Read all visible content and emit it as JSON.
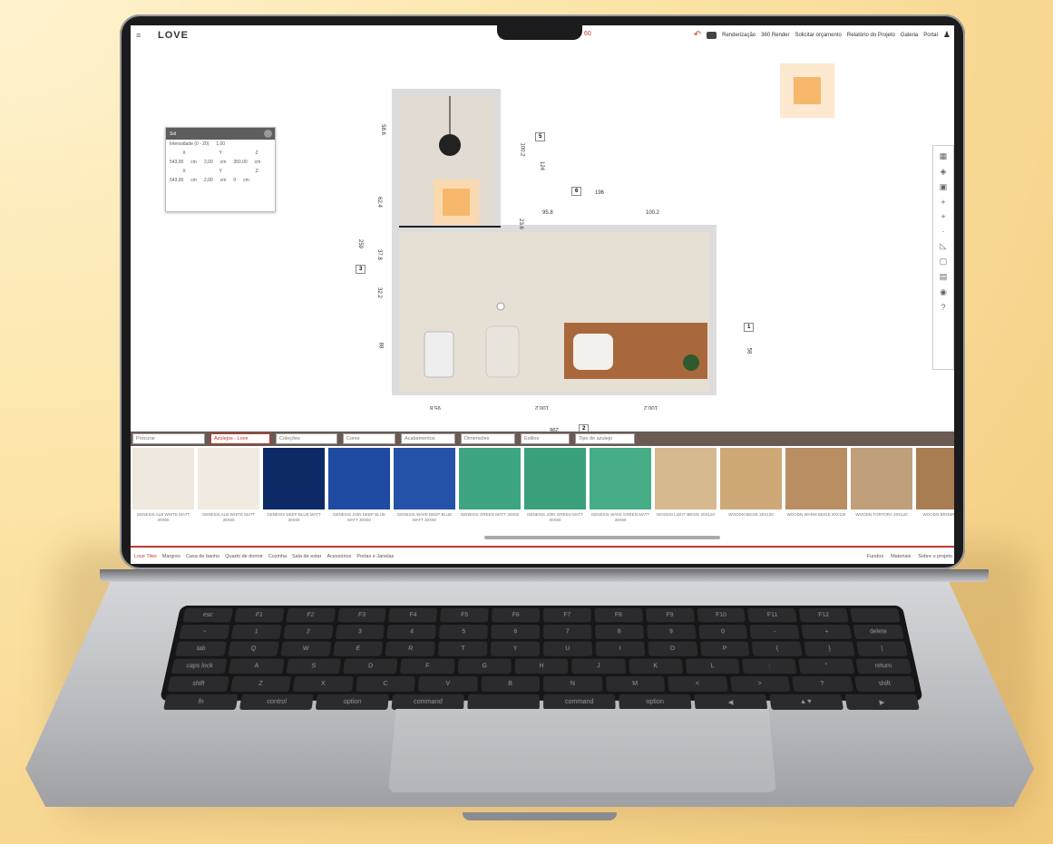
{
  "app": {
    "logo": "LOVE",
    "counter": "60",
    "nav": [
      "Renderização",
      "360 Render",
      "Solicitar orçamento",
      "Relatório do Projeto",
      "Galeria",
      "Portal"
    ]
  },
  "light_panel": {
    "title": "Sol",
    "intensity_label": "Intensidade (0 - 20)",
    "intensity_value": "1,00",
    "row1_headers": [
      "X",
      "Y",
      "Z"
    ],
    "row1_values": [
      "543,00",
      "cm",
      "2,00",
      "cm",
      "350,00",
      "cm"
    ],
    "row2_headers": [
      "X",
      "Y",
      "Z"
    ],
    "row2_values": [
      "543,00",
      "cm",
      "2,00",
      "cm",
      "0",
      "cm"
    ]
  },
  "dimensions": {
    "tags": [
      "5",
      "6",
      "3",
      "1",
      "2"
    ],
    "labels": [
      "58.6",
      "100.2",
      "124",
      "196",
      "95.8",
      "100.2",
      "62.4",
      "23.6",
      "259",
      "37.8",
      "32.2",
      "88",
      "58",
      "95.8",
      "100.2",
      "100.2",
      "296"
    ]
  },
  "filters": [
    "Procurar",
    "Azulejos - Love",
    "Coleções",
    "Cores",
    "Acabamentos",
    "Dimensões",
    "Estilos",
    "Tipo de azulejo"
  ],
  "tiles": [
    {
      "label": "GENESIS ALB WHITE MATT 30X60",
      "color": "#efe8de"
    },
    {
      "label": "GENESIS ALB WHITE MATT 30X60",
      "color": "#f1ebe1"
    },
    {
      "label": "GENESIS DEEP BLUE MATT 30X60",
      "color": "#0e2a66"
    },
    {
      "label": "GENESIS JOIN DEEP BLUE MATT 30X60",
      "color": "#1f4aa1"
    },
    {
      "label": "GENESIS WAVE DEEP BLUE MATT 30X60",
      "color": "#2452a8"
    },
    {
      "label": "GENESIS GREEN MATT 30X60",
      "color": "#3ea582"
    },
    {
      "label": "GENESIS JOIN GREEN MATT 30X60",
      "color": "#3aa07c"
    },
    {
      "label": "GENESIS WAVE GREEN MATT 30X60",
      "color": "#46ad86"
    },
    {
      "label": "WOODN LIGHT BEIGE 20X120",
      "color": "#d7b990"
    },
    {
      "label": "WOODN BEIGE 20X120",
      "color": "#cfa878"
    },
    {
      "label": "WOODN WARM BEIGE 20X120",
      "color": "#b98e62"
    },
    {
      "label": "WOODN TORTORA 20X120",
      "color": "#bfa07a"
    },
    {
      "label": "WOODN BROWN 20X120",
      "color": "#a97d52"
    }
  ],
  "tabs": [
    "Love Tiles",
    "Margres",
    "Casa de banho",
    "Quarto de dormir",
    "Cozinha",
    "Sala de estar",
    "Acessórios",
    "Portas e Janelas"
  ],
  "tabs_right": [
    "Fundos",
    "Materiais",
    "Sobre o projeto"
  ],
  "keyboard": {
    "row_fn": [
      "esc",
      "F1",
      "F2",
      "F3",
      "F4",
      "F5",
      "F6",
      "F7",
      "F8",
      "F9",
      "F10",
      "F11",
      "F12",
      ""
    ],
    "row_num": [
      "~",
      "1",
      "2",
      "3",
      "4",
      "5",
      "6",
      "7",
      "8",
      "9",
      "0",
      "-",
      "+",
      "delete"
    ],
    "row_q": [
      "tab",
      "Q",
      "W",
      "E",
      "R",
      "T",
      "Y",
      "U",
      "I",
      "O",
      "P",
      "{",
      "}",
      "|"
    ],
    "row_a": [
      "caps lock",
      "A",
      "S",
      "D",
      "F",
      "G",
      "H",
      "J",
      "K",
      "L",
      ":",
      "\"",
      "return"
    ],
    "row_z": [
      "shift",
      "Z",
      "X",
      "C",
      "V",
      "B",
      "N",
      "M",
      "<",
      ">",
      "?",
      "shift"
    ],
    "row_mod": [
      "fn",
      "control",
      "option",
      "command",
      "",
      "command",
      "option",
      "◀",
      "▲▼",
      "▶"
    ]
  }
}
